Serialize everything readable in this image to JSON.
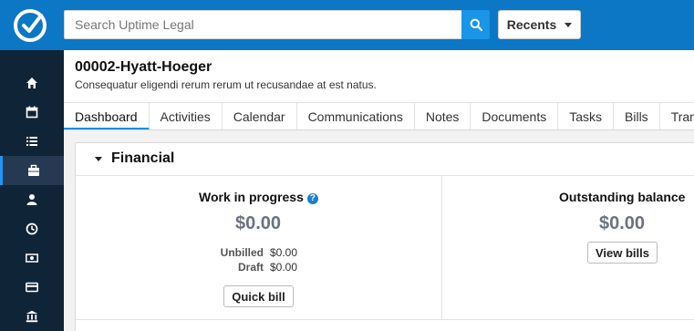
{
  "search": {
    "placeholder": "Search Uptime Legal"
  },
  "topbar": {
    "recents_label": "Recents"
  },
  "sidebar": {
    "items": [
      {
        "icon": "home-icon",
        "active": false
      },
      {
        "icon": "calendar-icon",
        "active": false
      },
      {
        "icon": "list-icon",
        "active": false
      },
      {
        "icon": "briefcase-icon",
        "active": true
      },
      {
        "icon": "user-icon",
        "active": false
      },
      {
        "icon": "clock-icon",
        "active": false
      },
      {
        "icon": "money-icon",
        "active": false
      },
      {
        "icon": "credit-card-icon",
        "active": false
      },
      {
        "icon": "bank-icon",
        "active": false
      }
    ]
  },
  "matter": {
    "title": "00002-Hyatt-Hoeger",
    "description": "Consequatur eligendi rerum rerum ut recusandae at est natus."
  },
  "tabs": [
    "Dashboard",
    "Activities",
    "Calendar",
    "Communications",
    "Notes",
    "Documents",
    "Tasks",
    "Bills",
    "Transacti"
  ],
  "financial": {
    "title": "Financial",
    "wip": {
      "title": "Work in progress",
      "help": "?",
      "amount": "$0.00",
      "unbilled_label": "Unbilled",
      "unbilled_value": "$0.00",
      "draft_label": "Draft",
      "draft_value": "$0.00",
      "button": "Quick bill"
    },
    "outstanding": {
      "title": "Outstanding balance",
      "amount": "$0.00",
      "button": "View bills"
    }
  },
  "colors": {
    "topbar": "#0b77c5",
    "sidebar": "#0f2437",
    "accent": "#1a8ee6"
  }
}
